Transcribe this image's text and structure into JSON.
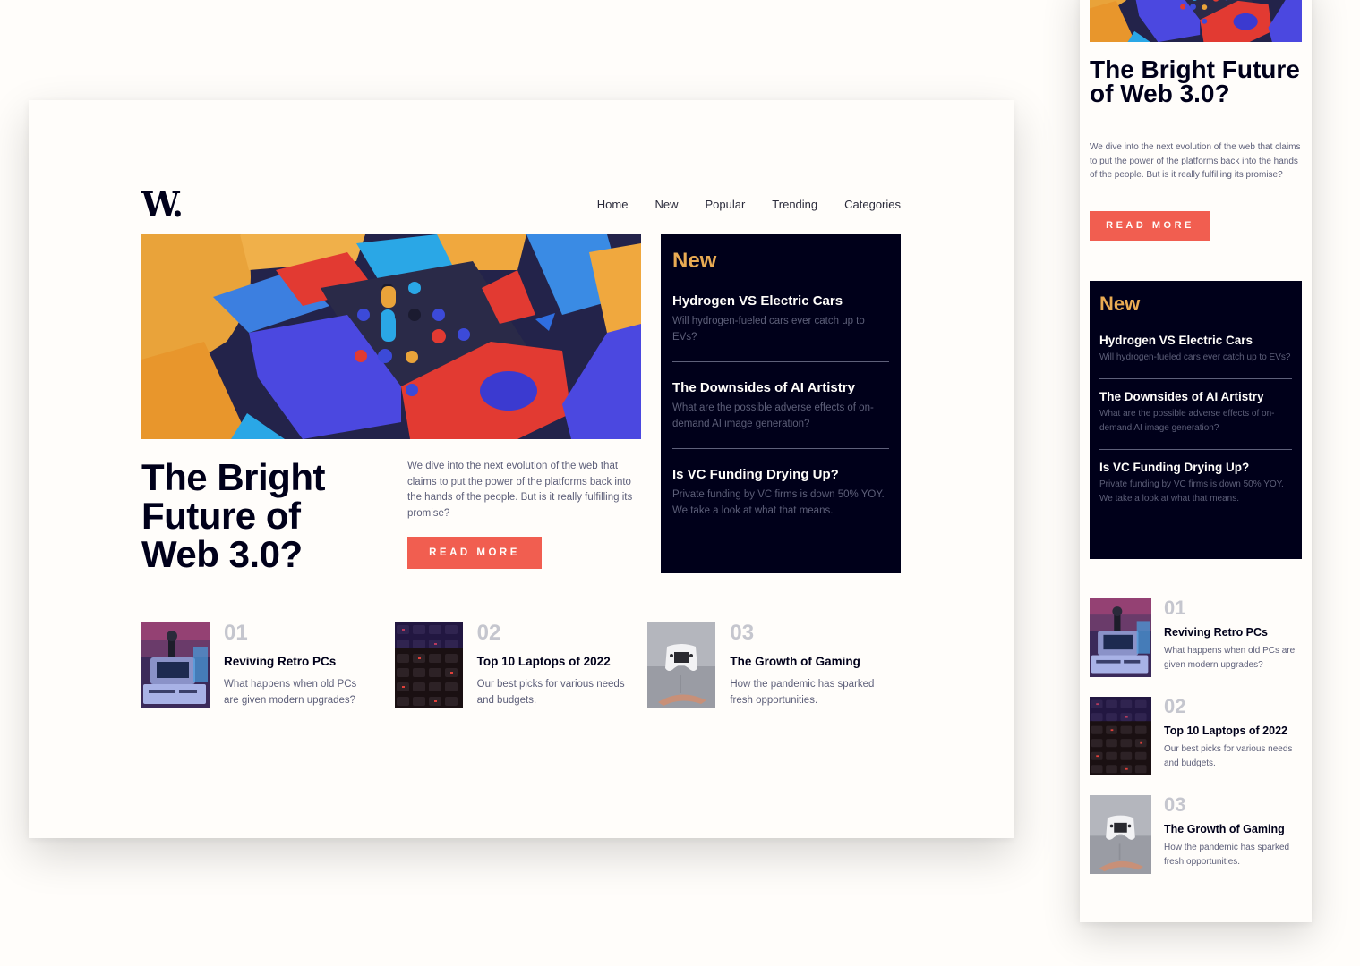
{
  "brand": {
    "logo": "W."
  },
  "nav": [
    "Home",
    "New",
    "Popular",
    "Trending",
    "Categories"
  ],
  "hero": {
    "title": "The Bright Future of Web 3.0?",
    "description": "We dive into the next evolution of the web that claims to put the power of the platforms back into the hands of the people. But is it really fulfilling its promise?",
    "button": "Read more"
  },
  "new_section": {
    "heading": "New",
    "items": [
      {
        "title": "Hydrogen VS Electric Cars",
        "desc": "Will hydrogen-fueled cars ever catch up to EVs?"
      },
      {
        "title": "The Downsides of AI Artistry",
        "desc": "What are the possible adverse effects of on-demand AI image generation?"
      },
      {
        "title": "Is VC Funding Drying Up?",
        "desc": "Private funding by VC firms is down 50% YOY. We take a look at what that means."
      }
    ]
  },
  "articles": [
    {
      "num": "01",
      "title": "Reviving Retro PCs",
      "desc": "What happens when old PCs are given modern upgrades?"
    },
    {
      "num": "02",
      "title": "Top 10 Laptops of 2022",
      "desc": "Our best picks for various needs and budgets."
    },
    {
      "num": "03",
      "title": "The Growth of Gaming",
      "desc": "How the pandemic has sparked fresh opportunities."
    }
  ],
  "colors": {
    "accent": "#f15e50",
    "dark": "#00001a",
    "orange": "#e9ab53",
    "off_white": "#fffdfa",
    "grayish_blue": "#c5c6ce",
    "dark_grayish_blue": "#5d5f79"
  }
}
